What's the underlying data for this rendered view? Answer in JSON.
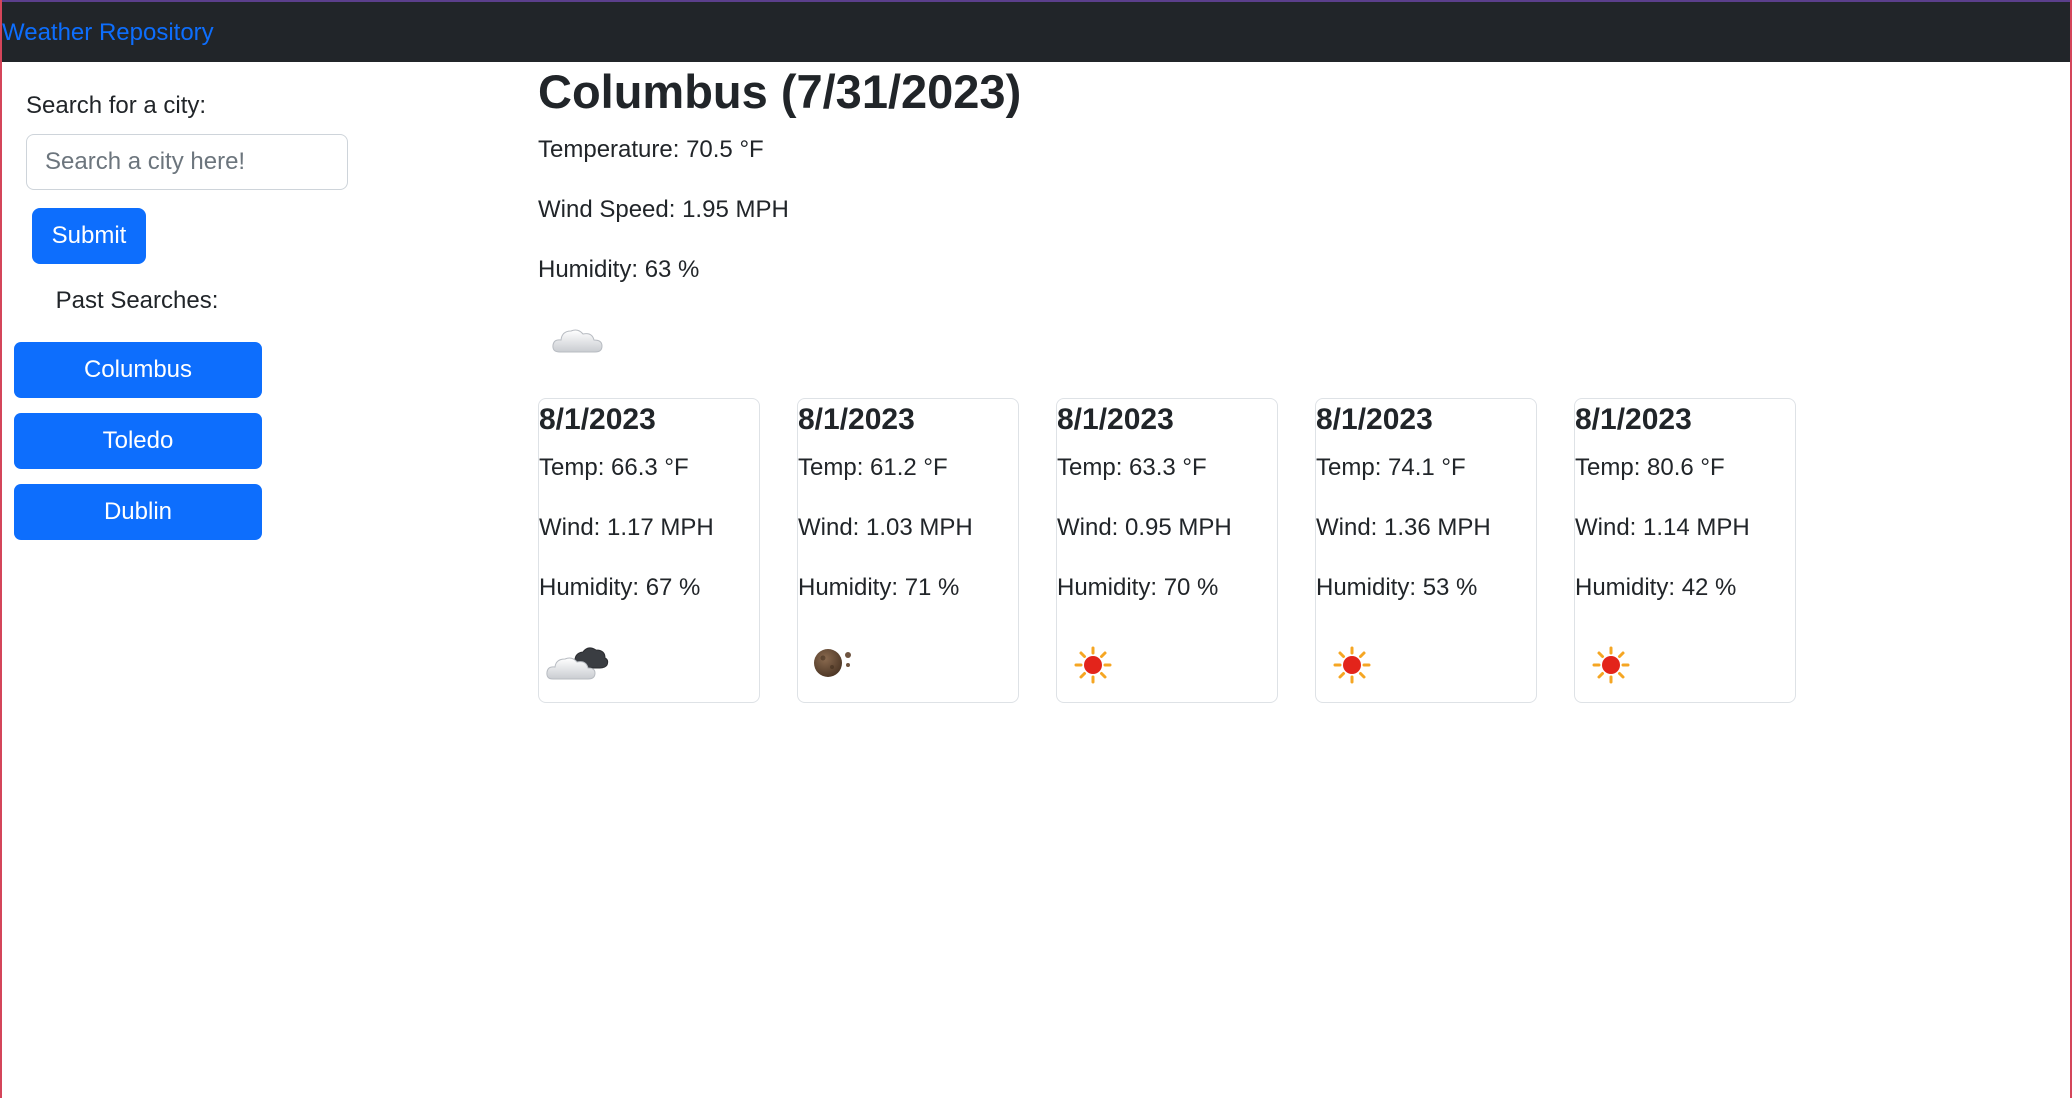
{
  "navbar": {
    "brand": "Weather Repository"
  },
  "search": {
    "label": "Search for a city:",
    "placeholder": "Search a city here!",
    "value": "",
    "submit_label": "Submit"
  },
  "history": {
    "label": "Past Searches:",
    "items": [
      "Columbus",
      "Toledo",
      "Dublin"
    ]
  },
  "current": {
    "title": "Columbus (7/31/2023)",
    "temperature": "Temperature: 70.5 °F",
    "wind": "Wind Speed: 1.95 MPH",
    "humidity": "Humidity: 63 %",
    "icon": "cloud-icon"
  },
  "forecast": [
    {
      "date": "8/1/2023",
      "temp": "Temp: 66.3 °F",
      "wind": "Wind: 1.17 MPH",
      "humidity": "Humidity: 67 %",
      "icon": "dark-cloud-icon"
    },
    {
      "date": "8/1/2023",
      "temp": "Temp: 61.2 °F",
      "wind": "Wind: 1.03 MPH",
      "humidity": "Humidity: 71 %",
      "icon": "moon-icon"
    },
    {
      "date": "8/1/2023",
      "temp": "Temp: 63.3 °F",
      "wind": "Wind: 0.95 MPH",
      "humidity": "Humidity: 70 %",
      "icon": "sun-icon"
    },
    {
      "date": "8/1/2023",
      "temp": "Temp: 74.1 °F",
      "wind": "Wind: 1.36 MPH",
      "humidity": "Humidity: 53 %",
      "icon": "sun-icon"
    },
    {
      "date": "8/1/2023",
      "temp": "Temp: 80.6 °F",
      "wind": "Wind: 1.14 MPH",
      "humidity": "Humidity: 42 %",
      "icon": "sun-icon"
    }
  ],
  "colors": {
    "navbar": "#212529",
    "accent": "#0d6efd",
    "sun": "#e3241b",
    "sun_rays": "#f5a623"
  }
}
